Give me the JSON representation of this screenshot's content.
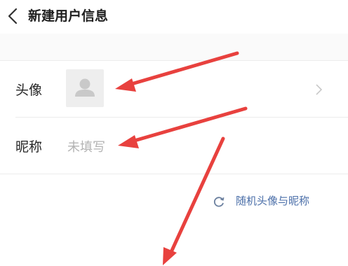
{
  "header": {
    "title": "新建用户信息"
  },
  "form": {
    "avatar_label": "头像",
    "nickname_label": "昵称",
    "nickname_placeholder": "未填写"
  },
  "actions": {
    "random_label": "随机头像与昵称"
  },
  "icons": {
    "back": "chevron-left-icon",
    "avatar": "person-icon",
    "row_arrow": "chevron-right-icon",
    "random": "refresh-icon"
  },
  "colors": {
    "link": "#4a6ea8",
    "annotation_arrow": "#e8413e",
    "placeholder": "#b3b3b3"
  }
}
